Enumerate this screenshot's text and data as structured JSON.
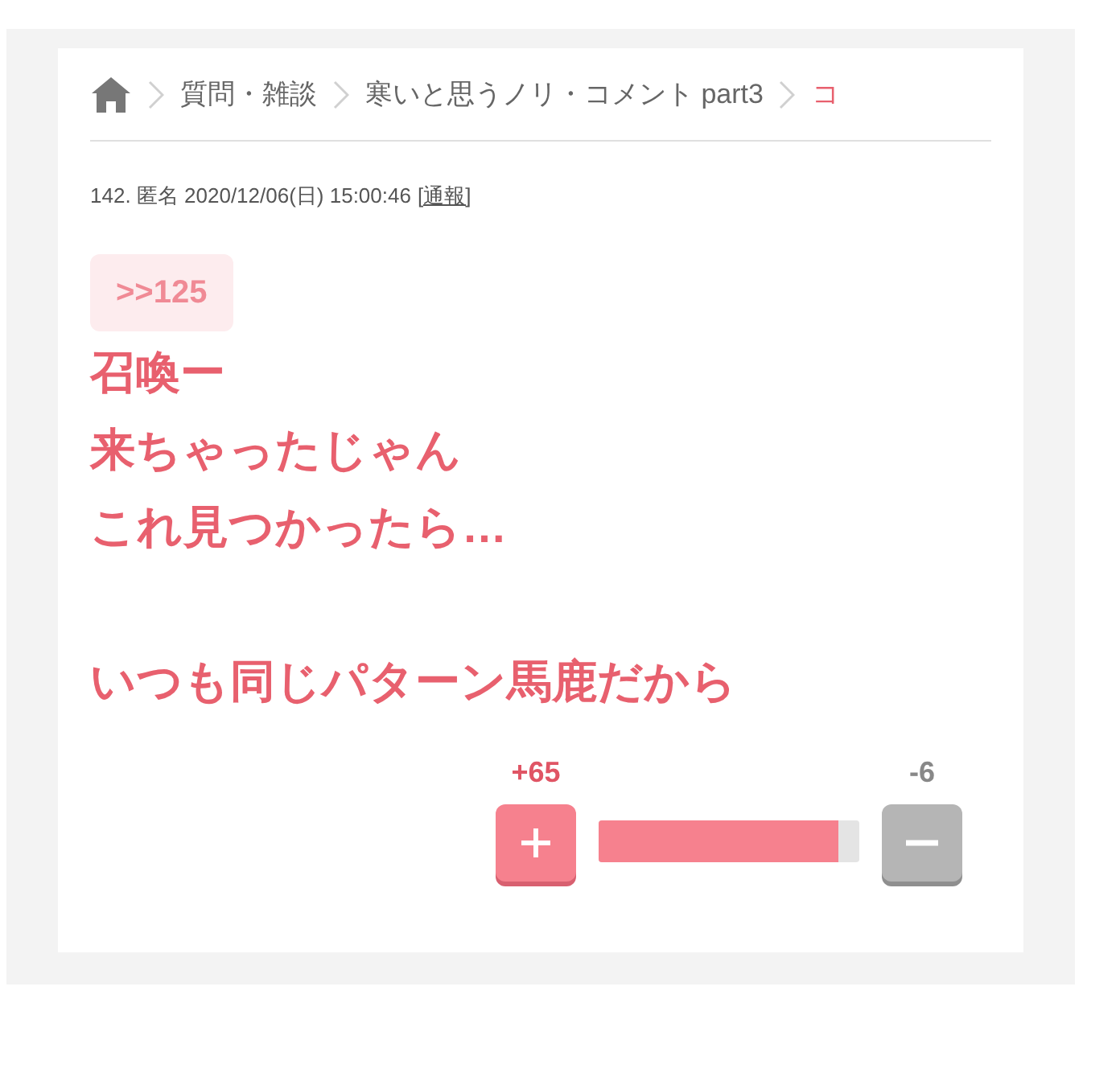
{
  "breadcrumb": [
    {
      "label": "質問・雑談",
      "current": false
    },
    {
      "label": "寒いと思うノリ・コメント part3",
      "current": false
    },
    {
      "label": "コ",
      "current": true
    }
  ],
  "post": {
    "meta": "142. 匿名 2020/12/06(日) 15:00:46",
    "report": "[通報]",
    "anchor": ">>125",
    "paragraphs": [
      [
        "召喚ー",
        "来ちゃったじゃん",
        "これ見つかったら…"
      ],
      [
        "いつも同じパターン馬鹿だから"
      ]
    ]
  },
  "votes": {
    "plus": "+65",
    "minus": "-6",
    "level": 0.92
  }
}
